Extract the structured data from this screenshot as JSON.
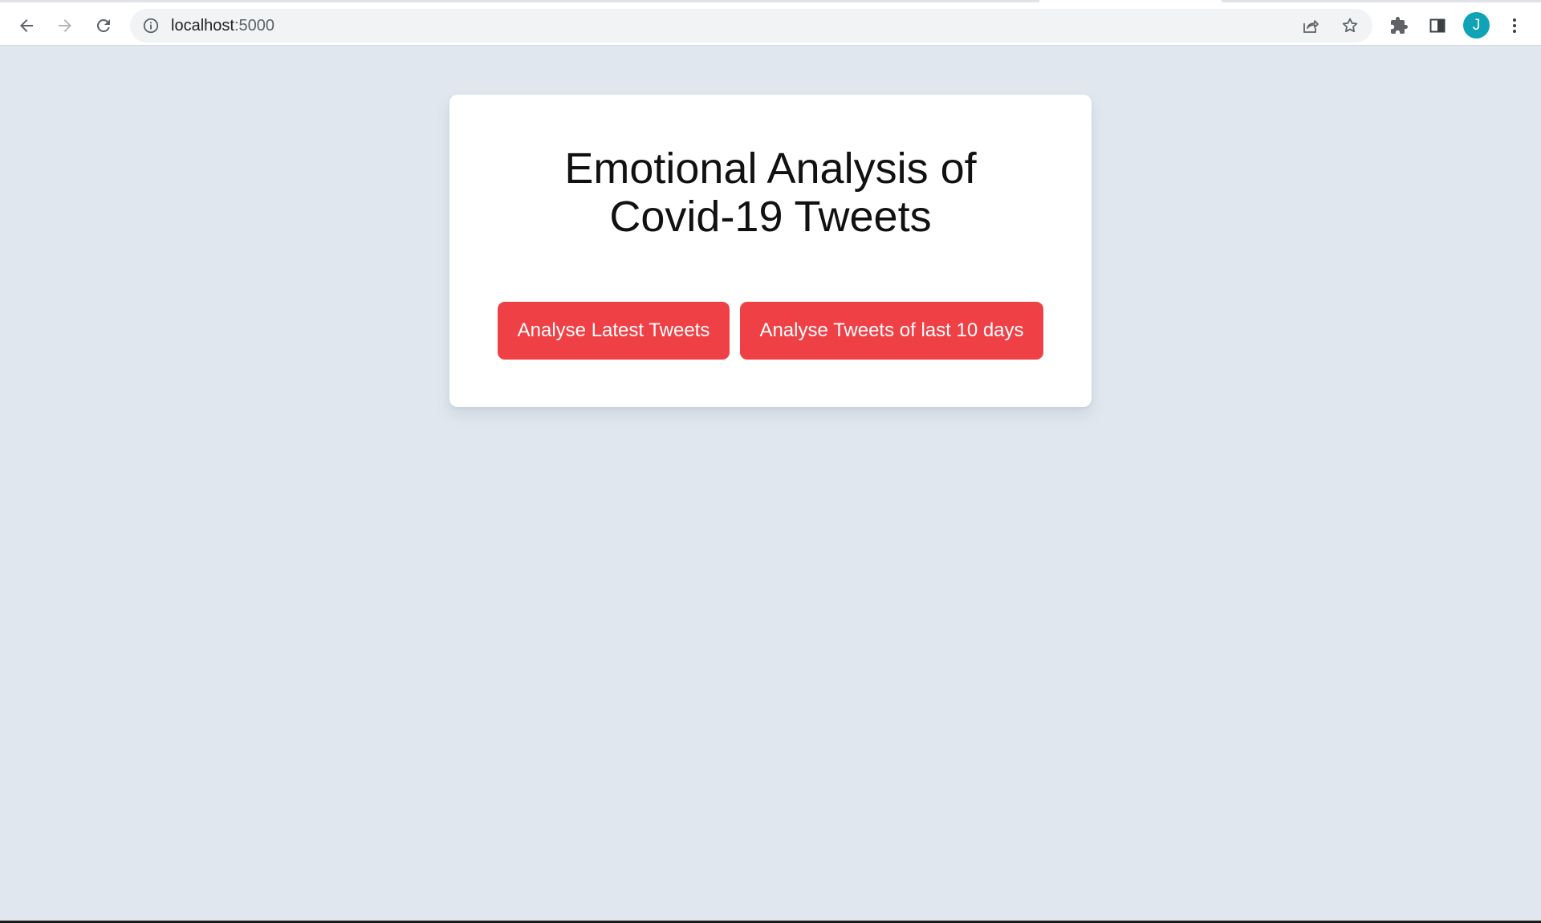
{
  "browser": {
    "url_host": "localhost",
    "url_port": ":5000",
    "avatar_initial": "J",
    "colors": {
      "avatar": "#10a3b5",
      "toolbar": "#ffffff",
      "omnibox": "#f1f3f4"
    }
  },
  "page": {
    "title_line1": "Emotional Analysis of",
    "title_line2": "Covid-19 Tweets",
    "buttons": {
      "latest": "Analyse Latest Tweets",
      "last10": "Analyse Tweets of last 10 days"
    },
    "colors": {
      "background": "#e0e7ef",
      "card": "#ffffff",
      "button": "#ef4046"
    }
  },
  "icons": [
    "back-icon",
    "forward-icon",
    "reload-icon",
    "site-info-icon",
    "share-icon",
    "bookmark-star-icon",
    "extensions-icon",
    "side-panel-icon",
    "more-menu-icon"
  ]
}
